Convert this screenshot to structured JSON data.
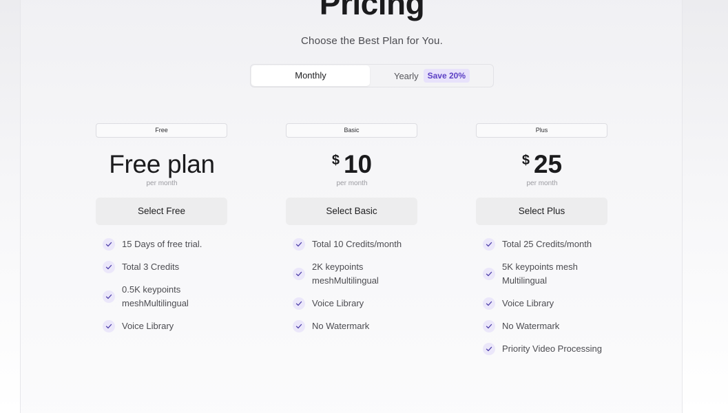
{
  "header": {
    "title": "Pricing",
    "subtitle": "Choose the Best Plan for You."
  },
  "billing_toggle": {
    "monthly_label": "Monthly",
    "yearly_label": "Yearly",
    "save_badge": "Save 20%",
    "selected": "Monthly"
  },
  "plans": [
    {
      "tag": "Free",
      "price_text": "Free plan",
      "currency": "",
      "amount": "",
      "period": "per month",
      "button_label": "Select Free",
      "features": [
        "15 Days of free trial.",
        "Total 3 Credits",
        "0.5K keypoints meshMultilingual",
        "Voice Library"
      ]
    },
    {
      "tag": "Basic",
      "price_text": "",
      "currency": "$",
      "amount": "10",
      "period": "per month",
      "button_label": "Select Basic",
      "features": [
        "Total 10 Credits/month",
        "2K keypoints meshMultilingual",
        "Voice Library",
        "No Watermark"
      ]
    },
    {
      "tag": "Plus",
      "price_text": "",
      "currency": "$",
      "amount": "25",
      "period": "per month",
      "button_label": "Select Plus",
      "features": [
        "Total 25 Credits/month",
        "5K keypoints mesh Multilingual",
        "Voice Library",
        "No Watermark",
        "Priority Video Processing"
      ]
    }
  ],
  "colors": {
    "accent": "#5b3fc4",
    "badge_bg": "#e8e2fb",
    "check_bg": "#ebe7fa",
    "button_bg": "#ededee"
  },
  "icons": {
    "feature_check": "check-icon"
  }
}
